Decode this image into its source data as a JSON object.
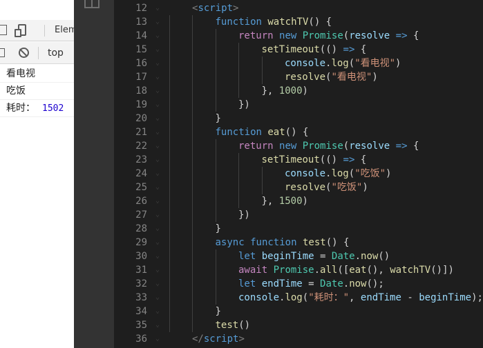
{
  "devtools": {
    "tabs": {
      "elements": "Elem"
    },
    "toolbar": {
      "context": "top"
    },
    "console": [
      {
        "text": "看电视",
        "value": null
      },
      {
        "text": "吃饭",
        "value": null
      },
      {
        "text": "耗时：",
        "value": "1502"
      }
    ]
  },
  "editor": {
    "lines": [
      {
        "n": "12",
        "tokens": [
          [
            "tag",
            "<"
          ],
          [
            "tname",
            "script"
          ],
          [
            "tag",
            ">"
          ]
        ]
      },
      {
        "n": "13",
        "tokens": [
          [
            "kw",
            "function"
          ],
          [
            "p",
            " "
          ],
          [
            "fn",
            "watchTV"
          ],
          [
            "p",
            "() {"
          ]
        ]
      },
      {
        "n": "14",
        "tokens": [
          [
            "ctl",
            "return"
          ],
          [
            "p",
            " "
          ],
          [
            "kw",
            "new"
          ],
          [
            "p",
            " "
          ],
          [
            "cls",
            "Promise"
          ],
          [
            "p",
            "("
          ],
          [
            "var",
            "resolve"
          ],
          [
            "p",
            " "
          ],
          [
            "kw",
            "=>"
          ],
          [
            "p",
            " {"
          ]
        ]
      },
      {
        "n": "15",
        "tokens": [
          [
            "fn",
            "setTimeout"
          ],
          [
            "p",
            "(() "
          ],
          [
            "kw",
            "=>"
          ],
          [
            "p",
            " {"
          ]
        ]
      },
      {
        "n": "16",
        "tokens": [
          [
            "var",
            "console"
          ],
          [
            "p",
            "."
          ],
          [
            "fn",
            "log"
          ],
          [
            "p",
            "("
          ],
          [
            "str",
            "\"看电视\""
          ],
          [
            "p",
            ")"
          ]
        ]
      },
      {
        "n": "17",
        "tokens": [
          [
            "fn",
            "resolve"
          ],
          [
            "p",
            "("
          ],
          [
            "str",
            "\"看电视\""
          ],
          [
            "p",
            ")"
          ]
        ]
      },
      {
        "n": "18",
        "tokens": [
          [
            "p",
            "}, "
          ],
          [
            "num",
            "1000"
          ],
          [
            "p",
            ")"
          ]
        ]
      },
      {
        "n": "19",
        "tokens": [
          [
            "p",
            "})"
          ]
        ]
      },
      {
        "n": "20",
        "tokens": [
          [
            "p",
            "}"
          ]
        ]
      },
      {
        "n": "21",
        "tokens": [
          [
            "kw",
            "function"
          ],
          [
            "p",
            " "
          ],
          [
            "fn",
            "eat"
          ],
          [
            "p",
            "() {"
          ]
        ]
      },
      {
        "n": "22",
        "tokens": [
          [
            "ctl",
            "return"
          ],
          [
            "p",
            " "
          ],
          [
            "kw",
            "new"
          ],
          [
            "p",
            " "
          ],
          [
            "cls",
            "Promise"
          ],
          [
            "p",
            "("
          ],
          [
            "var",
            "resolve"
          ],
          [
            "p",
            " "
          ],
          [
            "kw",
            "=>"
          ],
          [
            "p",
            " {"
          ]
        ]
      },
      {
        "n": "23",
        "tokens": [
          [
            "fn",
            "setTimeout"
          ],
          [
            "p",
            "(() "
          ],
          [
            "kw",
            "=>"
          ],
          [
            "p",
            " {"
          ]
        ]
      },
      {
        "n": "24",
        "tokens": [
          [
            "var",
            "console"
          ],
          [
            "p",
            "."
          ],
          [
            "fn",
            "log"
          ],
          [
            "p",
            "("
          ],
          [
            "str",
            "\"吃饭\""
          ],
          [
            "p",
            ")"
          ]
        ]
      },
      {
        "n": "25",
        "tokens": [
          [
            "fn",
            "resolve"
          ],
          [
            "p",
            "("
          ],
          [
            "str",
            "\"吃饭\""
          ],
          [
            "p",
            ")"
          ]
        ]
      },
      {
        "n": "26",
        "tokens": [
          [
            "p",
            "}, "
          ],
          [
            "num",
            "1500"
          ],
          [
            "p",
            ")"
          ]
        ]
      },
      {
        "n": "27",
        "tokens": [
          [
            "p",
            "})"
          ]
        ]
      },
      {
        "n": "28",
        "tokens": [
          [
            "p",
            "}"
          ]
        ]
      },
      {
        "n": "29",
        "tokens": [
          [
            "kw",
            "async"
          ],
          [
            "p",
            " "
          ],
          [
            "kw",
            "function"
          ],
          [
            "p",
            " "
          ],
          [
            "fn",
            "test"
          ],
          [
            "p",
            "() {"
          ]
        ]
      },
      {
        "n": "30",
        "tokens": [
          [
            "kw",
            "let"
          ],
          [
            "p",
            " "
          ],
          [
            "var",
            "beginTime"
          ],
          [
            "p",
            " = "
          ],
          [
            "cls",
            "Date"
          ],
          [
            "p",
            "."
          ],
          [
            "fn",
            "now"
          ],
          [
            "p",
            "()"
          ]
        ]
      },
      {
        "n": "31",
        "tokens": [
          [
            "ctl",
            "await"
          ],
          [
            "p",
            " "
          ],
          [
            "cls",
            "Promise"
          ],
          [
            "p",
            "."
          ],
          [
            "fn",
            "all"
          ],
          [
            "p",
            "(["
          ],
          [
            "fn",
            "eat"
          ],
          [
            "p",
            "(), "
          ],
          [
            "fn",
            "watchTV"
          ],
          [
            "p",
            "()])"
          ]
        ]
      },
      {
        "n": "32",
        "tokens": [
          [
            "kw",
            "let"
          ],
          [
            "p",
            " "
          ],
          [
            "var",
            "endTime"
          ],
          [
            "p",
            " = "
          ],
          [
            "cls",
            "Date"
          ],
          [
            "p",
            "."
          ],
          [
            "fn",
            "now"
          ],
          [
            "p",
            "();"
          ]
        ]
      },
      {
        "n": "33",
        "tokens": [
          [
            "var",
            "console"
          ],
          [
            "p",
            "."
          ],
          [
            "fn",
            "log"
          ],
          [
            "p",
            "("
          ],
          [
            "str",
            "\"耗时：\""
          ],
          [
            "p",
            ", "
          ],
          [
            "var",
            "endTime"
          ],
          [
            "p",
            " - "
          ],
          [
            "var",
            "beginTime"
          ],
          [
            "p",
            ");"
          ]
        ]
      },
      {
        "n": "34",
        "tokens": [
          [
            "p",
            "}"
          ]
        ]
      },
      {
        "n": "35",
        "tokens": [
          [
            "fn",
            "test"
          ],
          [
            "p",
            "()"
          ]
        ]
      },
      {
        "n": "36",
        "tokens": [
          [
            "tag",
            "</"
          ],
          [
            "tname",
            "script"
          ],
          [
            "tag",
            ">"
          ]
        ]
      }
    ]
  }
}
